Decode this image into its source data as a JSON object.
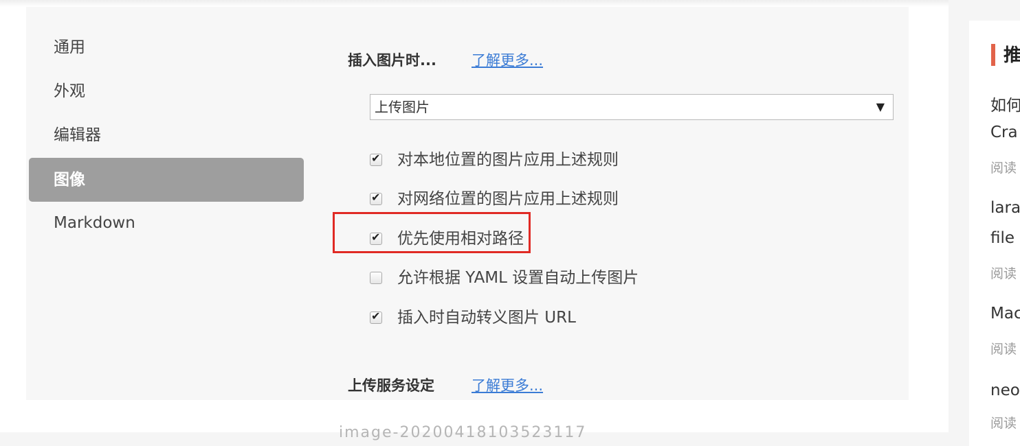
{
  "prefs": {
    "sidebar": {
      "items": [
        {
          "label": "通用"
        },
        {
          "label": "外观"
        },
        {
          "label": "编辑器"
        },
        {
          "label": "图像",
          "active": true
        },
        {
          "label": "Markdown"
        }
      ]
    },
    "insert_section": {
      "title": "插入图片时...",
      "learn_more": "了解更多...",
      "select_value": "上传图片",
      "options": [
        {
          "label": "对本地位置的图片应用上述规则",
          "checked": true
        },
        {
          "label": "对网络位置的图片应用上述规则",
          "checked": true
        },
        {
          "label": "优先使用相对路径",
          "checked": true,
          "highlighted": true
        },
        {
          "label": "允许根据 YAML 设置自动上传图片",
          "checked": false
        },
        {
          "label": "插入时自动转义图片 URL",
          "checked": true
        }
      ]
    },
    "upload_section": {
      "title": "上传服务设定",
      "learn_more": "了解更多..."
    }
  },
  "caption": "image-20200418103523117",
  "recommend": {
    "title": "推",
    "items": [
      {
        "line1": "如何",
        "line2": "Cra",
        "meta": "阅读"
      },
      {
        "line1": "lara",
        "line2": "file",
        "meta": "阅读"
      },
      {
        "line1": "Mac",
        "meta": "阅读"
      },
      {
        "line1": "neo",
        "meta": "阅读"
      }
    ]
  },
  "colors": {
    "accent": "#e2634a",
    "highlight": "#e02a24",
    "link": "#3a7bd5",
    "active_item": "#9e9e9e"
  }
}
